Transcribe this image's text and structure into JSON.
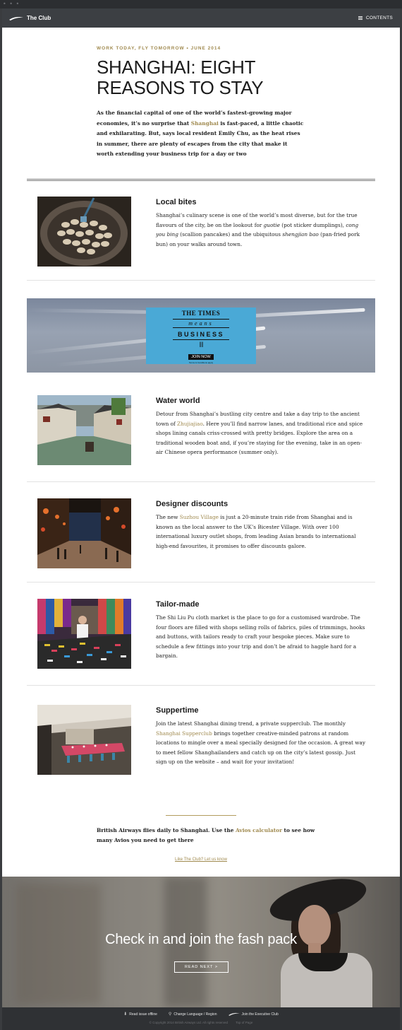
{
  "header": {
    "brand": "The Club",
    "menu_label": "CONTENTS"
  },
  "hero": {
    "kicker": "WORK TODAY, FLY TOMORROW • JUNE 2014",
    "title_line1": "SHANGHAI: EIGHT",
    "title_line2": "REASONS TO STAY",
    "intro_pre": "As the financial capital of one of the world’s fastest-growing major economies, it’s no surprise that ",
    "intro_link": "Shanghai",
    "intro_post": " is fast-paced, a little chaotic and exhilarating. But, says local resident Emily Chu, as the heat rises in summer, there are plenty of escapes from the city that make it worth extending your business trip for a day or two"
  },
  "sections": [
    {
      "title": "Local bites",
      "p1": "Shanghai’s culinary scene is one of the world’s most diverse, but for the true flavours of the city, be on the lookout for ",
      "em1": "guotie",
      "p2": " (pot sticker dumplings), ",
      "em2": "cong you bing",
      "p3": " (scallion pancakes) and the ubiquitous ",
      "em3": "shengjian bao",
      "p4": " (pan-fried pork bun) on your walks around town."
    },
    {
      "title": "Water world",
      "pre": "Detour from Shanghai’s bustling city centre and take a day trip to the ancient town of ",
      "link": "Zhujiajiao",
      "post": ". Here you’ll find narrow lanes, and traditional rice and spice shops lining canals criss-crossed with pretty bridges. Explore the area on a traditional wooden boat and, if you’re staying for the evening, take in an open-air Chinese opera performance (summer only)."
    },
    {
      "title": "Designer discounts",
      "pre": "The new ",
      "link": "Suzhou Village",
      "post": " is just a 20-minute train ride from Shanghai and is known as the local answer to the UK’s Bicester Village. With over 100 international luxury outlet shops, from leading Asian brands to international high-end favourites, it promises to offer discounts galore."
    },
    {
      "title": "Tailor-made",
      "text": "The Shi Liu Pu cloth market is the place to go for a customised wardrobe. The four floors are filled with shops selling rolls of fabrics, piles of trimmings, hooks and buttons, with tailors ready to craft your bespoke pieces. Make sure to schedule a few fittings into your trip and don’t be afraid to haggle hard for a bargain."
    },
    {
      "title": "Suppertime",
      "pre": "Join the latest Shanghai dining trend, a private supperclub. The monthly ",
      "link": "Shanghai Supperclub",
      "post": " brings together creative-minded patrons at random locations to mingle over a meal specially designed for the occasion. A great way to meet fellow Shanghailanders and catch up on the city’s latest gossip. Just sign up on the website – and wait for your invitation!"
    }
  ],
  "ad": {
    "times": "THE TIMES",
    "means": "means",
    "business": "BUSINESS",
    "join": "JOIN NOW",
    "terms": "Terms & Conditions apply"
  },
  "outro": {
    "pre": "British Airways flies daily to Shanghai. Use the ",
    "link": "Avios calculator",
    "post": " to see how many Avios you need to get there",
    "feedback": "Like The Club? Let us know"
  },
  "banner": {
    "headline": "Check in and join the fash pack",
    "button": "READ NEXT >"
  },
  "footer": {
    "offline": "Read issue offline",
    "language": "Change Language / Region",
    "exec": "Join the Executive Club",
    "copyright": "© Copyright 2014 British Airways Ltd. All rights reserved",
    "top": "Top of Page"
  },
  "colors": {
    "accent_gold": "#a08a4f",
    "topbar": "#3c3f43",
    "ad_blue": "#4aa9d6"
  }
}
